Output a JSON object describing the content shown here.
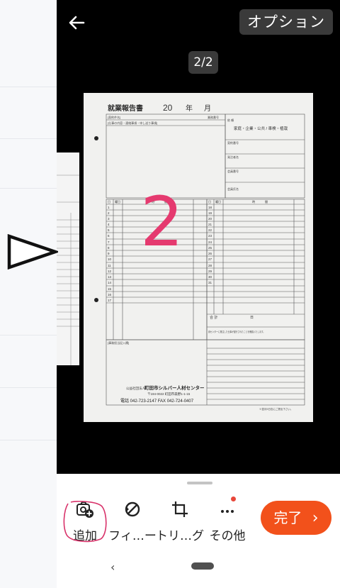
{
  "viewer": {
    "options_label": "オプション",
    "page_counter": "2/2"
  },
  "document": {
    "title": "就業報告書",
    "year": "20",
    "year_unit": "年",
    "month_unit": "月",
    "contract_name_label": "[契約件名]",
    "contract_no_label": "業務番号",
    "work_content_label": "[仕事の内容・連絡事項・申し送り事項]",
    "client_label": "依 頼",
    "client_types": "家庭・企業・公共 / 車検・植栽",
    "contract_number_label": "契約番号",
    "orderer_label": "発注者名",
    "member_number_label": "会員番号",
    "member_name_label": "会員氏名",
    "handwritten_number": "2",
    "table_header": [
      "日",
      "曜日",
      "時",
      "間"
    ],
    "days_left": [
      "1",
      "2",
      "3",
      "4",
      "5",
      "6",
      "7",
      "8",
      "9",
      "10",
      "11",
      "12",
      "13",
      "14",
      "15",
      "16",
      "17"
    ],
    "days_right": [
      "18",
      "19",
      "20",
      "21",
      "22",
      "23",
      "24",
      "25",
      "26",
      "27",
      "28",
      "29",
      "30",
      "31"
    ],
    "total_label": "合 計",
    "total_unit": "日",
    "confirm_note": "貴センターに発注した仕事が遂行されたことを確認いたします。",
    "staff_label": "[事務担当記入欄]",
    "org_type": "公益社団法人",
    "org_name": "町田市シルバー人材センター",
    "org_address": "〒194-0022 町田市森野1-1-15",
    "org_phone": "電話 042-723-2147  FAX 042-724-0407",
    "footer_note": "※翌月5日迄にご提出下さい。"
  },
  "toolbar": {
    "add_label": "追加",
    "filter_label": "フィ…ー",
    "trim_label": "トリ…グ",
    "more_label": "その他",
    "done_label": "完了"
  },
  "nav": {
    "back_glyph": "‹"
  },
  "colors": {
    "accent": "#f2511b",
    "notification_dot": "#e8473a",
    "annotation_pen": "#d8326a",
    "viewer_bg": "#000000"
  },
  "icons": [
    "back-arrow-icon",
    "add-photo-icon",
    "filter-icon",
    "crop-icon",
    "more-icon",
    "chevron-right-icon",
    "play-triangle-icon"
  ]
}
